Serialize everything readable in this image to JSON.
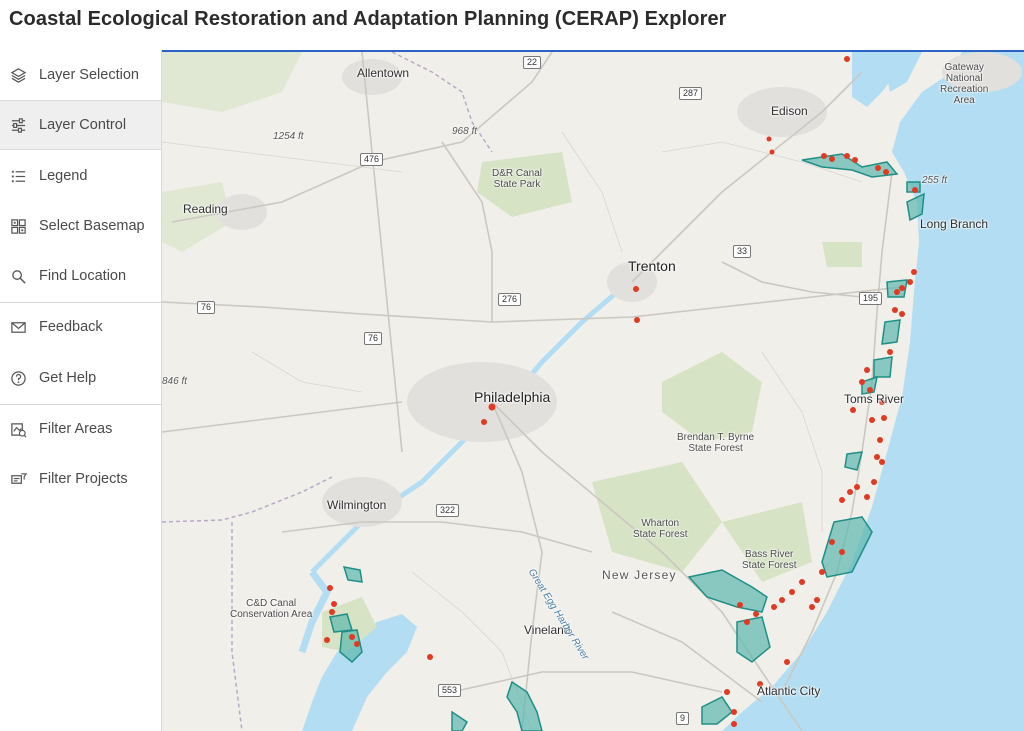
{
  "app": {
    "title": "Coastal Ecological Restoration and Adaptation Planning (CERAP) Explorer"
  },
  "sidebar": {
    "items": [
      {
        "label": "Layer Selection",
        "icon": "layers-icon"
      },
      {
        "label": "Layer Control",
        "icon": "sliders-icon",
        "active": true
      },
      {
        "label": "Legend",
        "icon": "legend-list-icon"
      },
      {
        "label": "Select Basemap",
        "icon": "basemap-grid-icon"
      },
      {
        "label": "Find Location",
        "icon": "search-icon"
      },
      {
        "label": "Feedback",
        "icon": "envelope-icon"
      },
      {
        "label": "Get Help",
        "icon": "help-circle-icon"
      },
      {
        "label": "Filter Areas",
        "icon": "filter-areas-icon"
      },
      {
        "label": "Filter Projects",
        "icon": "filter-projects-icon"
      }
    ]
  },
  "map": {
    "colors": {
      "land": "#f1efea",
      "water": "#b3ddf2",
      "park": "#d6e3c4",
      "area_fill": "#5cb8ae",
      "area_stroke": "#1f8f86",
      "project_point": "#e03a22",
      "road": "#c9c6c1",
      "state_line": "#b9a9c9"
    },
    "places": {
      "allentown": "Allentown",
      "edison": "Edison",
      "gateway": "Gateway\nNational\nRecreation\nArea",
      "reading": "Reading",
      "trenton": "Trenton",
      "long_branch": "Long Branch",
      "philadelphia": "Philadelphia",
      "toms_river": "Toms River",
      "wilmington": "Wilmington",
      "vineland": "Vineland",
      "atlantic_city": "Atlantic City",
      "new_jersey": "New Jersey",
      "dr_canal": "D&R Canal\nState Park",
      "byrne": "Brendan T. Byrne\nState Forest",
      "wharton": "Wharton\nState Forest",
      "bass_river": "Bass River\nState Forest",
      "cd_canal": "C&D Canal\nConservation Area",
      "river": "Great Egg Harbor River"
    },
    "elevations": {
      "e1254": "1254 ft",
      "e968": "968 ft",
      "e255": "255 ft",
      "e846": "846 ft"
    },
    "shields": {
      "r22": "22",
      "r287": "287",
      "r476": "476",
      "r33": "33",
      "r195": "195",
      "r276": "276",
      "r76a": "76",
      "r76b": "76",
      "r322": "322",
      "r553": "553",
      "r9": "9"
    }
  }
}
